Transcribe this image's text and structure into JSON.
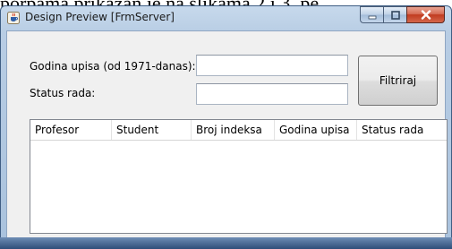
{
  "background_text": "porpama prikazan je na slikama 2 i 3, pe",
  "window": {
    "title": "Design Preview [FrmServer]",
    "icon": "java-cup-icon",
    "caption_buttons": [
      "minimize-icon",
      "maximize-icon",
      "close-icon"
    ]
  },
  "form": {
    "year_label": "Godina upisa (od 1971-danas):",
    "year_value": "",
    "status_label": "Status rada:",
    "status_value": "",
    "filter_button": "Filtriraj"
  },
  "table": {
    "columns": [
      "Profesor",
      "Student",
      "Broj indeksa",
      "Godina upisa",
      "Status rada"
    ],
    "rows": []
  },
  "colors": {
    "frame": "#b8cde4",
    "content": "#f0f0f0",
    "close_button": "#c13b20"
  }
}
